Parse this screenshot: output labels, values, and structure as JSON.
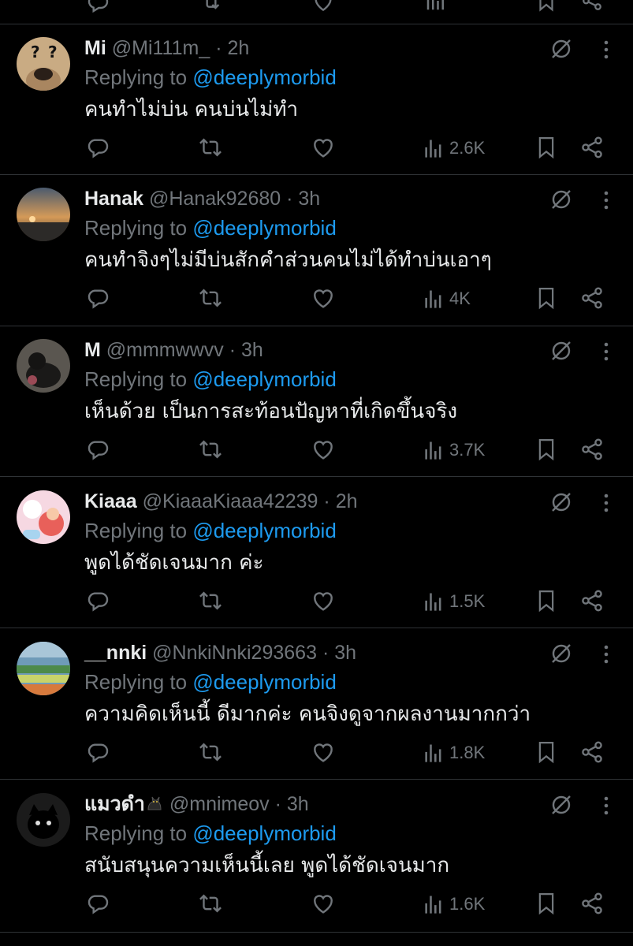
{
  "replying_label": "Replying to",
  "mention": "@deeplymorbid",
  "separator": "·",
  "colors": {
    "background": "#000000",
    "text": "#e7e9ea",
    "muted": "#71767b",
    "accent": "#1d9bf0",
    "divider": "#2f3336"
  },
  "icons": [
    "reply-icon",
    "repost-icon",
    "like-icon",
    "views-icon",
    "bookmark-icon",
    "share-icon",
    "grok-icon",
    "more-icon"
  ],
  "replies": [
    {
      "name": "Mi",
      "handle": "@Mi111m_",
      "time": "2h",
      "text": "คนทำไม่บ่น คนบ่นไม่ทำ",
      "views": "2.6K"
    },
    {
      "name": "Hanak",
      "handle": "@Hanak92680",
      "time": "3h",
      "text": "คนทำจิงๆไม่มีบ่นสักคำส่วนคนไม่ได้ทำบ่นเอาๆ",
      "views": "4K"
    },
    {
      "name": "M",
      "handle": "@mmmwwvv",
      "time": "3h",
      "text": "เห็นด้วย เป็นการสะท้อนปัญหาที่เกิดขึ้นจริง",
      "views": "3.7K"
    },
    {
      "name": "Kiaaa",
      "handle": "@KiaaaKiaaa42239",
      "time": "2h",
      "text": "พูดได้ชัดเจนมาก ค่ะ",
      "views": "1.5K"
    },
    {
      "name": "__nnki",
      "handle": "@NnkiNnki293663",
      "time": "3h",
      "text": "ความคิดเห็นนี้ ดีมากค่ะ คนจิงดูจากผลงานมากกว่า",
      "views": "1.8K"
    },
    {
      "name": "แมวดำ",
      "handle": "@mnimeov",
      "time": "3h",
      "text": "สนับสนุนความเห็นนี้เลย พูดได้ชัดเจนมาก",
      "views": "1.6K"
    }
  ]
}
